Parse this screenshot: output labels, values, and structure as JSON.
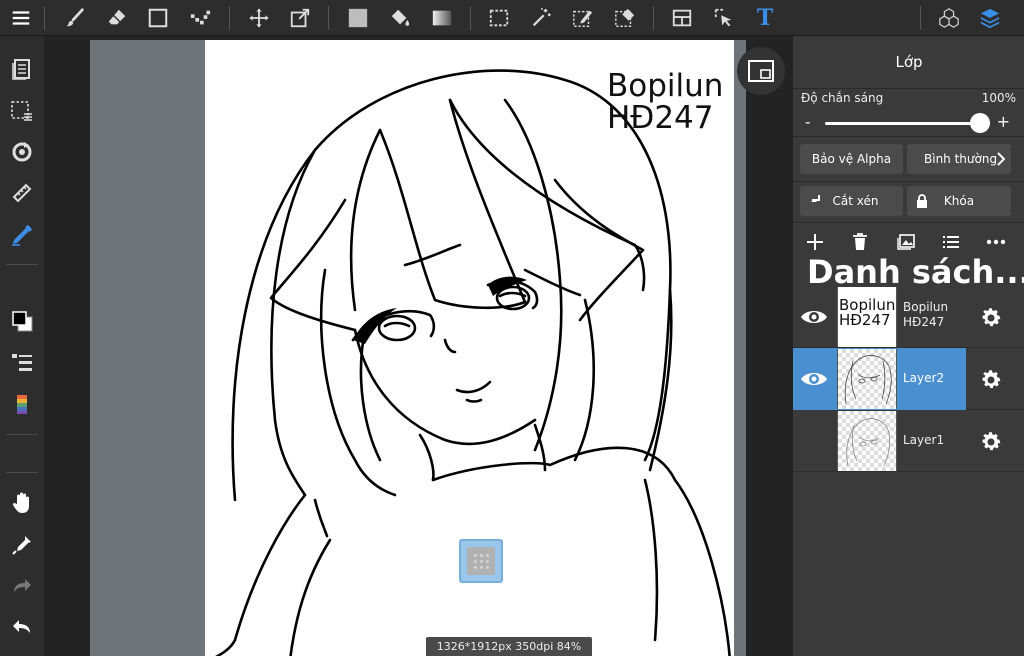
{
  "toolbar": {
    "icons": [
      "menu-icon",
      "brush-icon",
      "eraser-icon",
      "shape-icon",
      "dot-brush-icon",
      "move-icon",
      "transform-icon",
      "fill-color-icon",
      "bucket-icon",
      "gradient-icon",
      "select-rect-icon",
      "magic-wand-icon",
      "select-pen-icon",
      "select-eraser-icon",
      "layout-icon",
      "select-layer-icon",
      "text-icon",
      "3d-icon",
      "layers-icon"
    ],
    "text_tool_glyph": "T"
  },
  "canvas": {
    "watermark_line1": "Bopilun",
    "watermark_line2": "HĐ247",
    "status": "1326*1912px 350dpi 84%"
  },
  "panel": {
    "title": "Lớp",
    "opacity_label": "Độ chắn sáng",
    "opacity_value": "100%",
    "opacity_fraction": 1.0,
    "minus": "-",
    "plus": "+",
    "alpha_protect": "Bảo vệ Alpha",
    "blend_mode": "Bình thường",
    "clipping": "Cắt xén",
    "lock": "Khóa",
    "list_title": "Danh sách...",
    "layers": [
      {
        "name": "Bopilun HĐ247",
        "thumb_line1": "Bopilun",
        "thumb_line2": "HĐ247",
        "visible": true,
        "selected": false
      },
      {
        "name": "Layer2",
        "visible": true,
        "selected": true
      },
      {
        "name": "Layer1",
        "visible": false,
        "selected": false
      }
    ]
  },
  "colors": {
    "accent": "#4a90d0",
    "text_tool": "#3a8ee6"
  }
}
